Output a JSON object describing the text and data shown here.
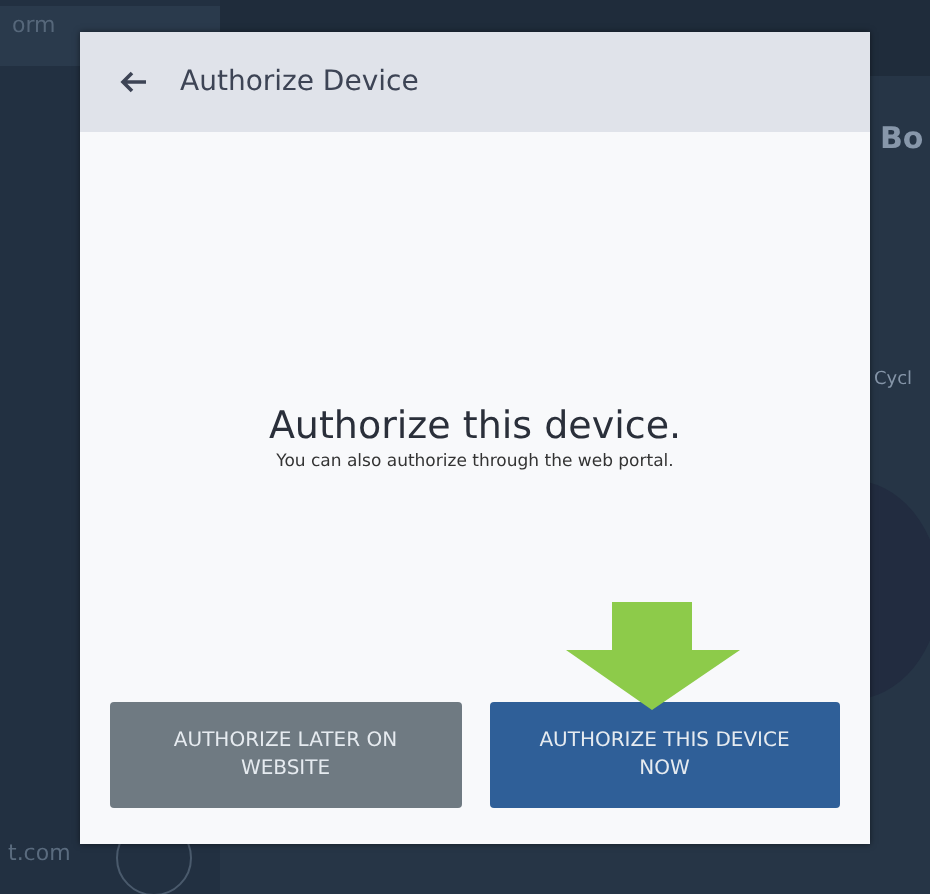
{
  "background": {
    "texts": [
      {
        "kind": "tab",
        "text": "orm"
      },
      {
        "kind": "heading",
        "text": "Bo"
      },
      {
        "kind": "label",
        "text": "Cycl"
      },
      {
        "kind": "footer",
        "text": "t.com"
      }
    ]
  },
  "dialog": {
    "title": "Authorize Device",
    "heading": "Authorize this device.",
    "message": "You can also authorize through the web portal.",
    "buttons": [
      {
        "kind": "secondary",
        "label": "AUTHORIZE LATER ON WEBSITE"
      },
      {
        "kind": "primary",
        "label": "AUTHORIZE THIS DEVICE NOW",
        "highlighted": true
      }
    ]
  }
}
